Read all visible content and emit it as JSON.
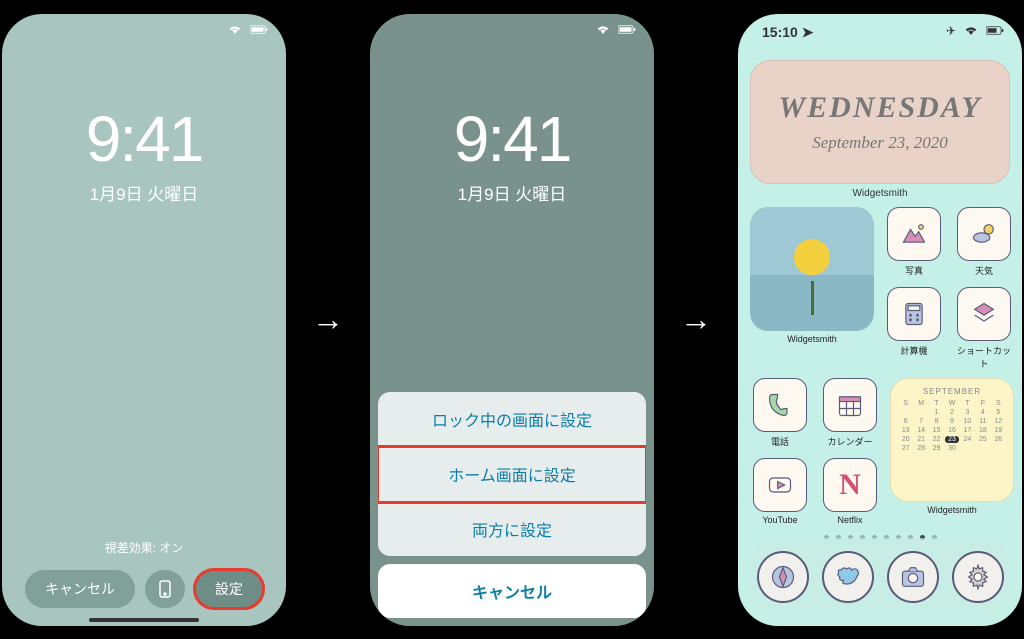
{
  "screen1": {
    "time": "9:41",
    "date": "1月9日 火曜日",
    "perspective": "視差効果: オン",
    "cancel": "キャンセル",
    "set": "設定"
  },
  "screen2": {
    "time": "9:41",
    "date": "1月9日 火曜日",
    "sheet": {
      "lock": "ロック中の画面に設定",
      "home": "ホーム画面に設定",
      "both": "両方に設定",
      "cancel": "キャンセル"
    }
  },
  "screen3": {
    "status_time": "15:10",
    "widget1": {
      "day": "WEDNESDAY",
      "date": "September 23, 2020",
      "label": "Widgetsmith"
    },
    "widget_photo_label": "Widgetsmith",
    "apps": {
      "photos": "写真",
      "weather": "天気",
      "calculator": "計算機",
      "shortcuts": "ショートカット",
      "phone": "電話",
      "calendar": "カレンダー",
      "youtube": "YouTube",
      "netflix": "Netflix"
    },
    "calendar_widget": {
      "month": "SEPTEMBER",
      "label": "Widgetsmith",
      "today": "23"
    }
  }
}
